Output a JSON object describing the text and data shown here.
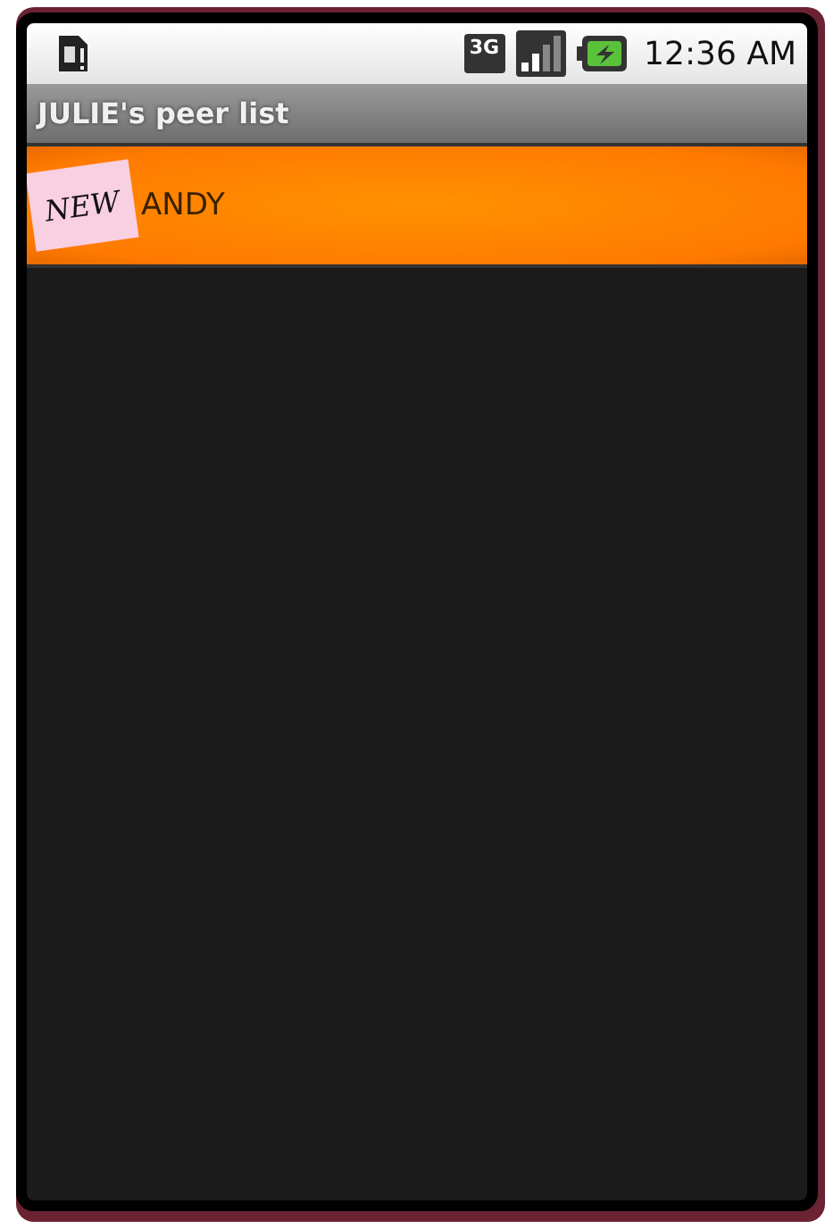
{
  "status_bar": {
    "network": "3G",
    "time": "12:36 AM"
  },
  "title": "JULIE's peer list",
  "peers": [
    {
      "name": "ANDY",
      "badge": "NEW",
      "selected": true
    }
  ]
}
